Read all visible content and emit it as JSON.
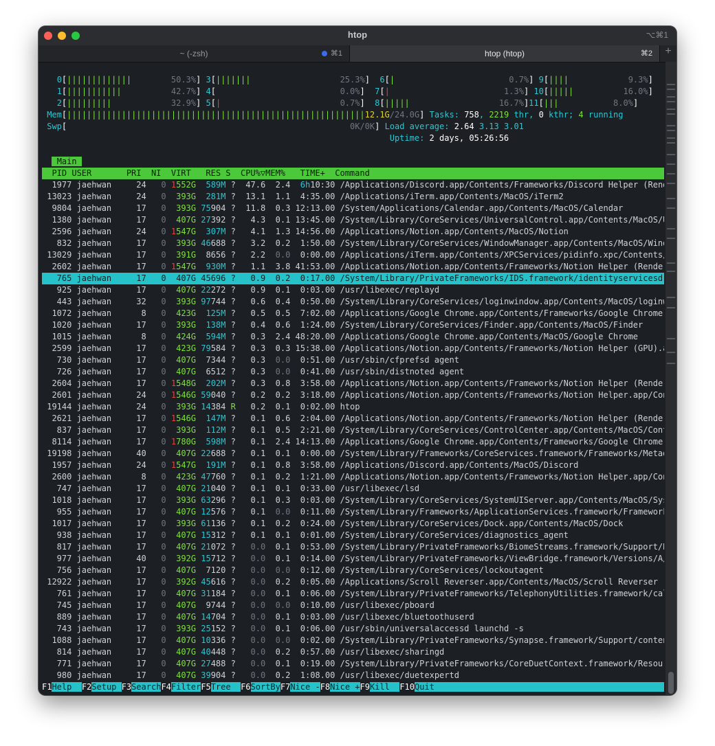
{
  "window": {
    "title": "htop",
    "shortcut": "⌥⌘1"
  },
  "tabs": [
    {
      "label": "~ (-zsh)",
      "shortcut": "⌘1",
      "active": false
    },
    {
      "label": "htop (htop)",
      "shortcut": "⌘2",
      "active": true
    }
  ],
  "new_tab_label": "+",
  "meters": [
    {
      "label": "0",
      "bars": "|||||||||||||",
      "value": "50.3%"
    },
    {
      "label": "1",
      "bars": "|||||||||||",
      "value": "42.7%"
    },
    {
      "label": "2",
      "bars": "|||||||||",
      "value": "32.9%"
    },
    {
      "label": "3",
      "bars": "|||||||",
      "value": "25.3%"
    },
    {
      "label": "4",
      "bars": "",
      "value": "0.0%"
    },
    {
      "label": "5",
      "bars": "|",
      "value": "0.7%"
    },
    {
      "label": "6",
      "bars": "|",
      "value": "0.7%"
    },
    {
      "label": "7",
      "bars": "|",
      "value": "1.3%"
    },
    {
      "label": "8",
      "bars": "|||||",
      "value": "16.7%"
    },
    {
      "label": "9",
      "bars": "||||",
      "value": "9.3%"
    },
    {
      "label": "10",
      "bars": "|||||",
      "value": "16.0%"
    },
    {
      "label": "11",
      "bars": "|||",
      "value": "8.0%"
    }
  ],
  "mem": {
    "label": "Mem",
    "bars": "||||||||||||||||||||||||||||||||||||||||||||||||||||||||||||",
    "value": "12.1G",
    "total": "/24.0G"
  },
  "swp": {
    "label": "Swp",
    "value": "0K/0K"
  },
  "tasks": {
    "label": "Tasks:",
    "count": "758",
    "thr": "2219",
    "kthr": "0",
    "running": "4"
  },
  "load": {
    "label": "Load average:",
    "one": "2.64",
    "five": "3.13",
    "fifteen": "3.01"
  },
  "uptime": {
    "label": "Uptime:",
    "value": "2 days, 05:26:56"
  },
  "screen_tab": "Main",
  "header": "  PID USER       PRI  NI  VIRT   RES S  CPU%▽MEM%   TIME+  Command",
  "selected_index": 8,
  "rows": [
    "1977 jaehwan     24   0 1552G  589M ?  47.6  2.4  6h10:30 /Applications/Discord.app/Contents/Frameworks/Discord Helper (Renderer",
    "13023 jaehwan     24   0  393G  281M ?  13.1  1.1  4:35.00 /Applications/iTerm.app/Contents/MacOS/iTerm2",
    "9804 jaehwan     17   0  393G 75904 ?  11.8  0.3 12:13.00 /System/Applications/Calendar.app/Contents/MacOS/Calendar",
    "1380 jaehwan     17   0  407G 27392 ?   4.3  0.1 13:45.00 /System/Library/CoreServices/UniversalControl.app/Contents/MacOS/Unive",
    "2596 jaehwan     24   0 1547G  307M ?   4.1  1.3 14:56.00 /Applications/Notion.app/Contents/MacOS/Notion",
    "832 jaehwan     17   0  393G 46688 ?   3.2  0.2  1:50.00 /System/Library/CoreServices/WindowManager.app/Contents/MacOS/WindowMa",
    "13029 jaehwan     17   0  391G  8656 ?   2.2  0.0  0:00.00 /Applications/iTerm.app/Contents/XPCServices/pidinfo.xpc/Contents/MacO",
    "2602 jaehwan     17   0 1547G  930M ?   1.1  3.8 41:53.00 /Applications/Notion.app/Contents/Frameworks/Notion Helper (Renderer).",
    "765 jaehwan     17   0  407G 45696 ?   0.9  0.2  0:17.00 /System/Library/PrivateFrameworks/IDS.framework/identityservicesd.app/",
    "925 jaehwan     17   0  407G 22272 ?   0.9  0.1  0:03.00 /usr/libexec/replayd",
    "443 jaehwan     32   0  393G 97744 ?   0.6  0.4  0:50.00 /System/Library/CoreServices/loginwindow.app/Contents/MacOS/loginwindo",
    "1072 jaehwan      8   0  423G  125M ?   0.5  0.5  7:02.00 /Applications/Google Chrome.app/Contents/Frameworks/Google Chrome Fram",
    "1020 jaehwan     17   0  393G  138M ?   0.4  0.6  1:24.00 /System/Library/CoreServices/Finder.app/Contents/MacOS/Finder",
    "1015 jaehwan      8   0  424G  594M ?   0.3  2.4 48:20.00 /Applications/Google Chrome.app/Contents/MacOS/Google Chrome",
    "2599 jaehwan     17   0  423G 79584 ?   0.3  0.3 15:38.00 /Applications/Notion.app/Contents/Frameworks/Notion Helper (GPU).app/C",
    "730 jaehwan     17   0  407G  7344 ?   0.3  0.0  0:51.00 /usr/sbin/cfprefsd agent",
    "726 jaehwan     17   0  407G  6512 ?   0.3  0.0  0:41.00 /usr/sbin/distnoted agent",
    "2604 jaehwan     17   0 1548G  202M ?   0.3  0.8  3:58.00 /Applications/Notion.app/Contents/Frameworks/Notion Helper (Renderer).",
    "2601 jaehwan     24   0 1546G 59040 ?   0.2  0.2  3:18.00 /Applications/Notion.app/Contents/Frameworks/Notion Helper.app/Content",
    "19144 jaehwan     24   0  393G 14384 R   0.2  0.1  0:02.00 htop",
    "2621 jaehwan     17   0 1546G  147M ?   0.1  0.6  2:04.00 /Applications/Notion.app/Contents/Frameworks/Notion Helper (Renderer).",
    "837 jaehwan     17   0  393G  112M ?   0.1  0.5  2:21.00 /System/Library/CoreServices/ControlCenter.app/Contents/MacOS/ControlC",
    "8114 jaehwan     17   0 1780G  598M ?   0.1  2.4 14:13.00 /Applications/Google Chrome.app/Contents/Frameworks/Google Chrome Fram",
    "19198 jaehwan     40   0  407G 22688 ?   0.1  0.1  0:00.00 /System/Library/Frameworks/CoreServices.framework/Frameworks/Metadata.",
    "1957 jaehwan     24   0 1547G  191M ?   0.1  0.8  3:58.00 /Applications/Discord.app/Contents/MacOS/Discord",
    "2600 jaehwan      8   0  423G 47760 ?   0.1  0.2  1:21.00 /Applications/Notion.app/Contents/Frameworks/Notion Helper.app/Content",
    "747 jaehwan     17   0  407G 21040 ?   0.1  0.1  0:33.00 /usr/libexec/lsd",
    "1018 jaehwan     17   0  393G 63296 ?   0.1  0.3  0:03.00 /System/Library/CoreServices/SystemUIServer.app/Contents/MacOS/SystemU",
    "955 jaehwan     17   0  407G 12576 ?   0.1  0.0  0:11.00 /System/Library/Frameworks/ApplicationServices.framework/Frameworks/AT",
    "1017 jaehwan     17   0  393G 61136 ?   0.1  0.2  0:24.00 /System/Library/CoreServices/Dock.app/Contents/MacOS/Dock",
    "938 jaehwan     17   0  407G 15312 ?   0.1  0.1  0:01.00 /System/Library/CoreServices/diagnostics_agent",
    "817 jaehwan     17   0  407G 21072 ?   0.0  0.1  0:53.00 /System/Library/PrivateFrameworks/BiomeStreams.framework/Support/Biome",
    "977 jaehwan     40   0  392G 15712 ?   0.0  0.1  0:14.00 /System/Library/PrivateFrameworks/ViewBridge.framework/Versions/A/XPCS",
    "756 jaehwan     17   0  407G  7120 ?   0.0  0.0  0:12.00 /System/Library/CoreServices/lockoutagent",
    "12922 jaehwan     17   0  392G 45616 ?   0.0  0.2  0:05.00 /Applications/Scroll Reverser.app/Contents/MacOS/Scroll Reverser",
    "761 jaehwan     17   0  407G 31184 ?   0.0  0.1  0:06.00 /System/Library/PrivateFrameworks/TelephonyUtilities.framework/callser",
    "745 jaehwan     17   0  407G  9744 ?   0.0  0.0  0:10.00 /usr/libexec/pboard",
    "889 jaehwan     17   0  407G 14704 ?   0.0  0.1  0:03.00 /usr/libexec/bluetoothuserd",
    "743 jaehwan     17   0  393G 25152 ?   0.0  0.1  0:06.00 /usr/sbin/universalaccessd launchd -s",
    "1088 jaehwan     17   0  407G 10336 ?   0.0  0.0  0:02.00 /System/Library/PrivateFrameworks/Synapse.framework/Support/contentlin",
    "814 jaehwan     17   0  407G 40448 ?   0.0  0.2  0:57.00 /usr/libexec/sharingd",
    "771 jaehwan     17   0  407G 27488 ?   0.0  0.1  0:19.00 /System/Library/PrivateFrameworks/CoreDuetContext.framework/Resources/",
    "980 jaehwan     17   0  407G 39904 ?   0.0  0.2  1:08.00 /usr/libexec/duetexpertd"
  ],
  "function_keys": [
    {
      "key": "F1",
      "label": "Help  "
    },
    {
      "key": "F2",
      "label": "Setup "
    },
    {
      "key": "F3",
      "label": "Search"
    },
    {
      "key": "F4",
      "label": "Filter"
    },
    {
      "key": "F5",
      "label": "Tree  "
    },
    {
      "key": "F6",
      "label": "SortBy"
    },
    {
      "key": "F7",
      "label": "Nice -"
    },
    {
      "key": "F8",
      "label": "Nice +"
    },
    {
      "key": "F9",
      "label": "Kill  "
    },
    {
      "key": "F10",
      "label": "Quit  "
    }
  ],
  "colors": {
    "cyan": "#2fc6d1",
    "green": "#7ee23a",
    "red": "#e04a3a",
    "header": "#4cc83b",
    "selection": "#26c2c9"
  }
}
